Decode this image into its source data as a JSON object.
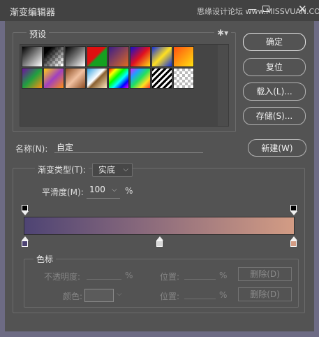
{
  "window": {
    "title": "渐变编辑器",
    "watermark": "思缘设计论坛 www.MISSVUAN.COM",
    "minimize_glyph": "—",
    "close_glyph": "✕"
  },
  "presets": {
    "legend": "预设",
    "gear_glyph": "✱",
    "gear_arrow": "▾",
    "swatches": [
      {
        "name": "black-white",
        "css": "linear-gradient(135deg,#000 0%,#fff 100%)"
      },
      {
        "name": "black-transparent",
        "css": "linear-gradient(135deg,#000 20%,rgba(0,0,0,0) 90%), repeating-conic-gradient(#bbb 0% 25%, #fff 0% 50%) 0 0/8px 8px"
      },
      {
        "name": "black-white-sharp",
        "css": "linear-gradient(135deg,#000 0%,#777 50%,#fff 100%)"
      },
      {
        "name": "red-green",
        "css": "linear-gradient(135deg,#e01010 0%,#e01010 45%,#15a020 55%,#15a020 100%)"
      },
      {
        "name": "violet-orange",
        "css": "linear-gradient(135deg,#3a1e8a 0%,#e06a20 100%)"
      },
      {
        "name": "blue-red-yellow",
        "css": "linear-gradient(135deg,#1010d0 0%,#e01020 50%,#ffe010 100%)"
      },
      {
        "name": "blue-yellow-blue",
        "css": "linear-gradient(135deg,#1030e0 0%,#ffe020 50%,#1030e0 100%)"
      },
      {
        "name": "orange-yellow",
        "css": "linear-gradient(135deg,#ff5010 0%,#ffe010 100%)"
      },
      {
        "name": "violet-green-orange",
        "css": "linear-gradient(135deg,#7010a0 0%,#20a040 50%,#ff9010 100%)"
      },
      {
        "name": "yellow-violet-orange",
        "css": "linear-gradient(135deg,#ffd010 0%,#a040c0 50%,#ff9010 100%)"
      },
      {
        "name": "copper",
        "css": "linear-gradient(135deg,#8a4a20 0%,#f0c0a0 50%,#8a4a20 100%)"
      },
      {
        "name": "chrome",
        "css": "linear-gradient(135deg,#30a0e0 0%,#fff 45%,#8a6030 55%,#ffe8c0 100%)"
      },
      {
        "name": "spectrum",
        "css": "linear-gradient(135deg,#f00,#ff0,#0f0,#0ff,#00f,#f0f)"
      },
      {
        "name": "transparent-rainbow",
        "css": "linear-gradient(135deg,#e020ff,#20a0ff,#20e060,#ffe020,#ff3030)"
      },
      {
        "name": "stripes",
        "css": "repeating-linear-gradient(135deg,#000 0 3px,#fff 3px 6px)"
      },
      {
        "name": "transparent-checker",
        "css": "repeating-conic-gradient(#bbb 0% 25%, #fff 0% 50%) 0 0/8px 8px"
      }
    ]
  },
  "buttons": {
    "ok": "确定",
    "reset": "复位",
    "load": "载入(L)...",
    "save": "存储(S)...",
    "new": "新建(W)"
  },
  "name": {
    "label": "名称(N):",
    "value": "自定"
  },
  "gradient": {
    "type_label": "渐变类型(T):",
    "type_value": "实底",
    "smooth_label": "平滑度(M):",
    "smooth_value": "100",
    "smooth_unit": "%",
    "colors": {
      "start": "#4e4474",
      "mid": "#8a6a7c",
      "end": "#d39c84"
    }
  },
  "color_stops": {
    "legend": "色标",
    "opacity_label": "不透明度:",
    "opacity_unit": "%",
    "position_label": "位置:",
    "position_unit": "%",
    "color_label": "颜色:",
    "delete_label": "删除(D)"
  }
}
